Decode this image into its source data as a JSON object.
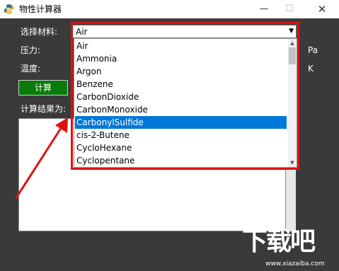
{
  "window": {
    "title": "物性计算器",
    "minimize": "—",
    "maximize": "☐",
    "close": "✕"
  },
  "form": {
    "material_label": "选择材料:",
    "pressure_label": "压力:",
    "pressure_unit": "Pa",
    "temperature_label": "温度:",
    "temperature_unit": "K",
    "calculate_label": "计算",
    "result_label": "计算结果为:"
  },
  "combo": {
    "selected_value": "Air",
    "arrow": "▼"
  },
  "dropdown": {
    "options": [
      "Air",
      "Ammonia",
      "Argon",
      "Benzene",
      "CarbonDioxide",
      "CarbonMonoxide",
      "CarbonylSulfide",
      "cis-2-Butene",
      "CycloHexane",
      "Cyclopentane"
    ],
    "highlighted_index": 6,
    "scroll_up": "▲",
    "scroll_down": "▼"
  },
  "watermark": {
    "logo": "下载吧",
    "url": "www.xiazaiba.com"
  },
  "colors": {
    "background": "#3a3a3a",
    "calc_button": "#0a7a0a",
    "highlight": "#0078d7",
    "annotation": "#e01010"
  }
}
